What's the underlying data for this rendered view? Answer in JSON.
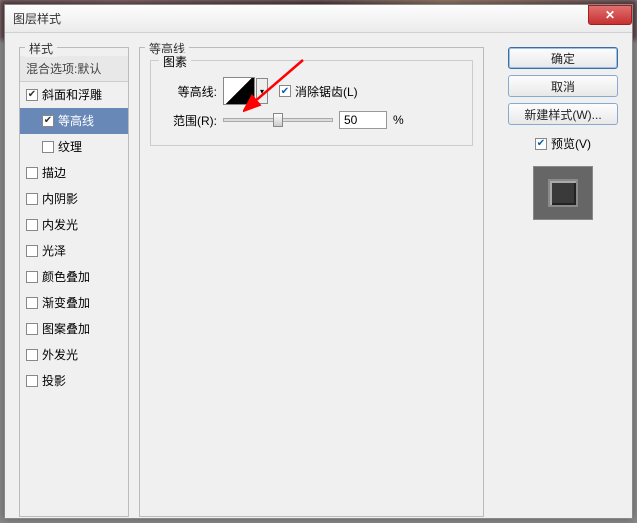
{
  "window": {
    "title": "图层样式",
    "close": "✕"
  },
  "styles_panel": {
    "label": "样式",
    "blend_options": "混合选项:默认",
    "items": [
      {
        "label": "斜面和浮雕",
        "checked": true,
        "selected": false,
        "indent": 0
      },
      {
        "label": "等高线",
        "checked": true,
        "selected": true,
        "indent": 1
      },
      {
        "label": "纹理",
        "checked": false,
        "selected": false,
        "indent": 1
      },
      {
        "label": "描边",
        "checked": false,
        "selected": false,
        "indent": 0
      },
      {
        "label": "内阴影",
        "checked": false,
        "selected": false,
        "indent": 0
      },
      {
        "label": "内发光",
        "checked": false,
        "selected": false,
        "indent": 0
      },
      {
        "label": "光泽",
        "checked": false,
        "selected": false,
        "indent": 0
      },
      {
        "label": "颜色叠加",
        "checked": false,
        "selected": false,
        "indent": 0
      },
      {
        "label": "渐变叠加",
        "checked": false,
        "selected": false,
        "indent": 0
      },
      {
        "label": "图案叠加",
        "checked": false,
        "selected": false,
        "indent": 0
      },
      {
        "label": "外发光",
        "checked": false,
        "selected": false,
        "indent": 0
      },
      {
        "label": "投影",
        "checked": false,
        "selected": false,
        "indent": 0
      }
    ]
  },
  "contour_panel": {
    "label": "等高线",
    "element_label": "图素",
    "contour_label": "等高线:",
    "antialias_label": "消除锯齿(L)",
    "antialias_checked": true,
    "range_label": "范围(R):",
    "range_value": "50",
    "range_unit": "%"
  },
  "right_panel": {
    "ok": "确定",
    "cancel": "取消",
    "new_style": "新建样式(W)...",
    "preview_label": "预览(V)",
    "preview_checked": true
  }
}
